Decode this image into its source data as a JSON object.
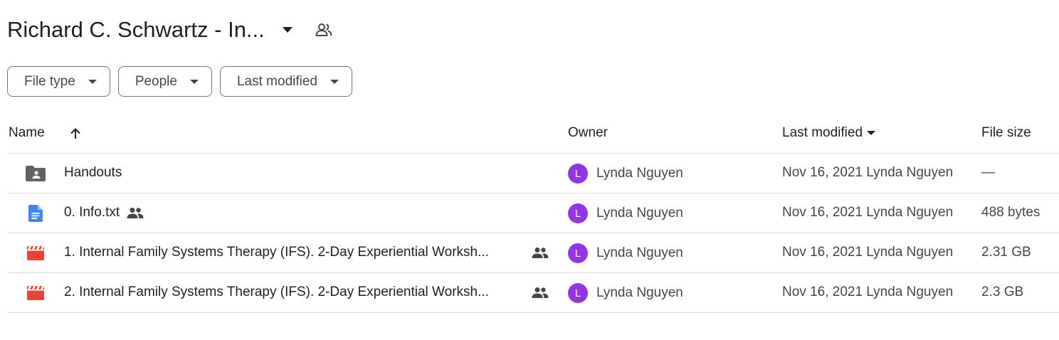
{
  "header": {
    "title": "Richard C. Schwartz - In...",
    "title_dropdown_icon": "arrow-drop-down-icon",
    "shared_icon": "people-icon"
  },
  "filters": [
    {
      "label": "File type",
      "icon": "arrow-drop-down-icon"
    },
    {
      "label": "People",
      "icon": "arrow-drop-down-icon"
    },
    {
      "label": "Last modified",
      "icon": "arrow-drop-down-icon"
    }
  ],
  "table": {
    "columns": {
      "name": "Name",
      "owner": "Owner",
      "last_modified": "Last modified",
      "file_size": "File size"
    },
    "name_sort_icon": "arrow-upward-icon",
    "modified_sort_icon": "arrow-drop-down-icon",
    "rows": [
      {
        "type": "shared-folder",
        "icon": "shared-folder-icon",
        "name": "Handouts",
        "shared": false,
        "owner_initial": "L",
        "owner": "Lynda Nguyen",
        "modified": "Nov 16, 2021 Lynda Nguyen",
        "size": "—"
      },
      {
        "type": "document",
        "icon": "google-docs-icon",
        "name": "0. Info.txt",
        "shared": true,
        "owner_initial": "L",
        "owner": "Lynda Nguyen",
        "modified": "Nov 16, 2021 Lynda Nguyen",
        "size": "488 bytes"
      },
      {
        "type": "video",
        "icon": "video-file-icon",
        "name": "1. Internal Family Systems Therapy (IFS).  2-Day Experiential Worksh...",
        "shared": true,
        "owner_initial": "L",
        "owner": "Lynda Nguyen",
        "modified": "Nov 16, 2021 Lynda Nguyen",
        "size": "2.31 GB"
      },
      {
        "type": "video",
        "icon": "video-file-icon",
        "name": "2. Internal Family Systems Therapy (IFS).  2-Day Experiential Worksh...",
        "shared": true,
        "owner_initial": "L",
        "owner": "Lynda Nguyen",
        "modified": "Nov 16, 2021 Lynda Nguyen",
        "size": "2.3 GB"
      }
    ]
  },
  "colors": {
    "avatar": "#9334e6",
    "docs_blue": "#4285f4",
    "video_red": "#ea4335",
    "folder_gray": "#5f6368"
  }
}
